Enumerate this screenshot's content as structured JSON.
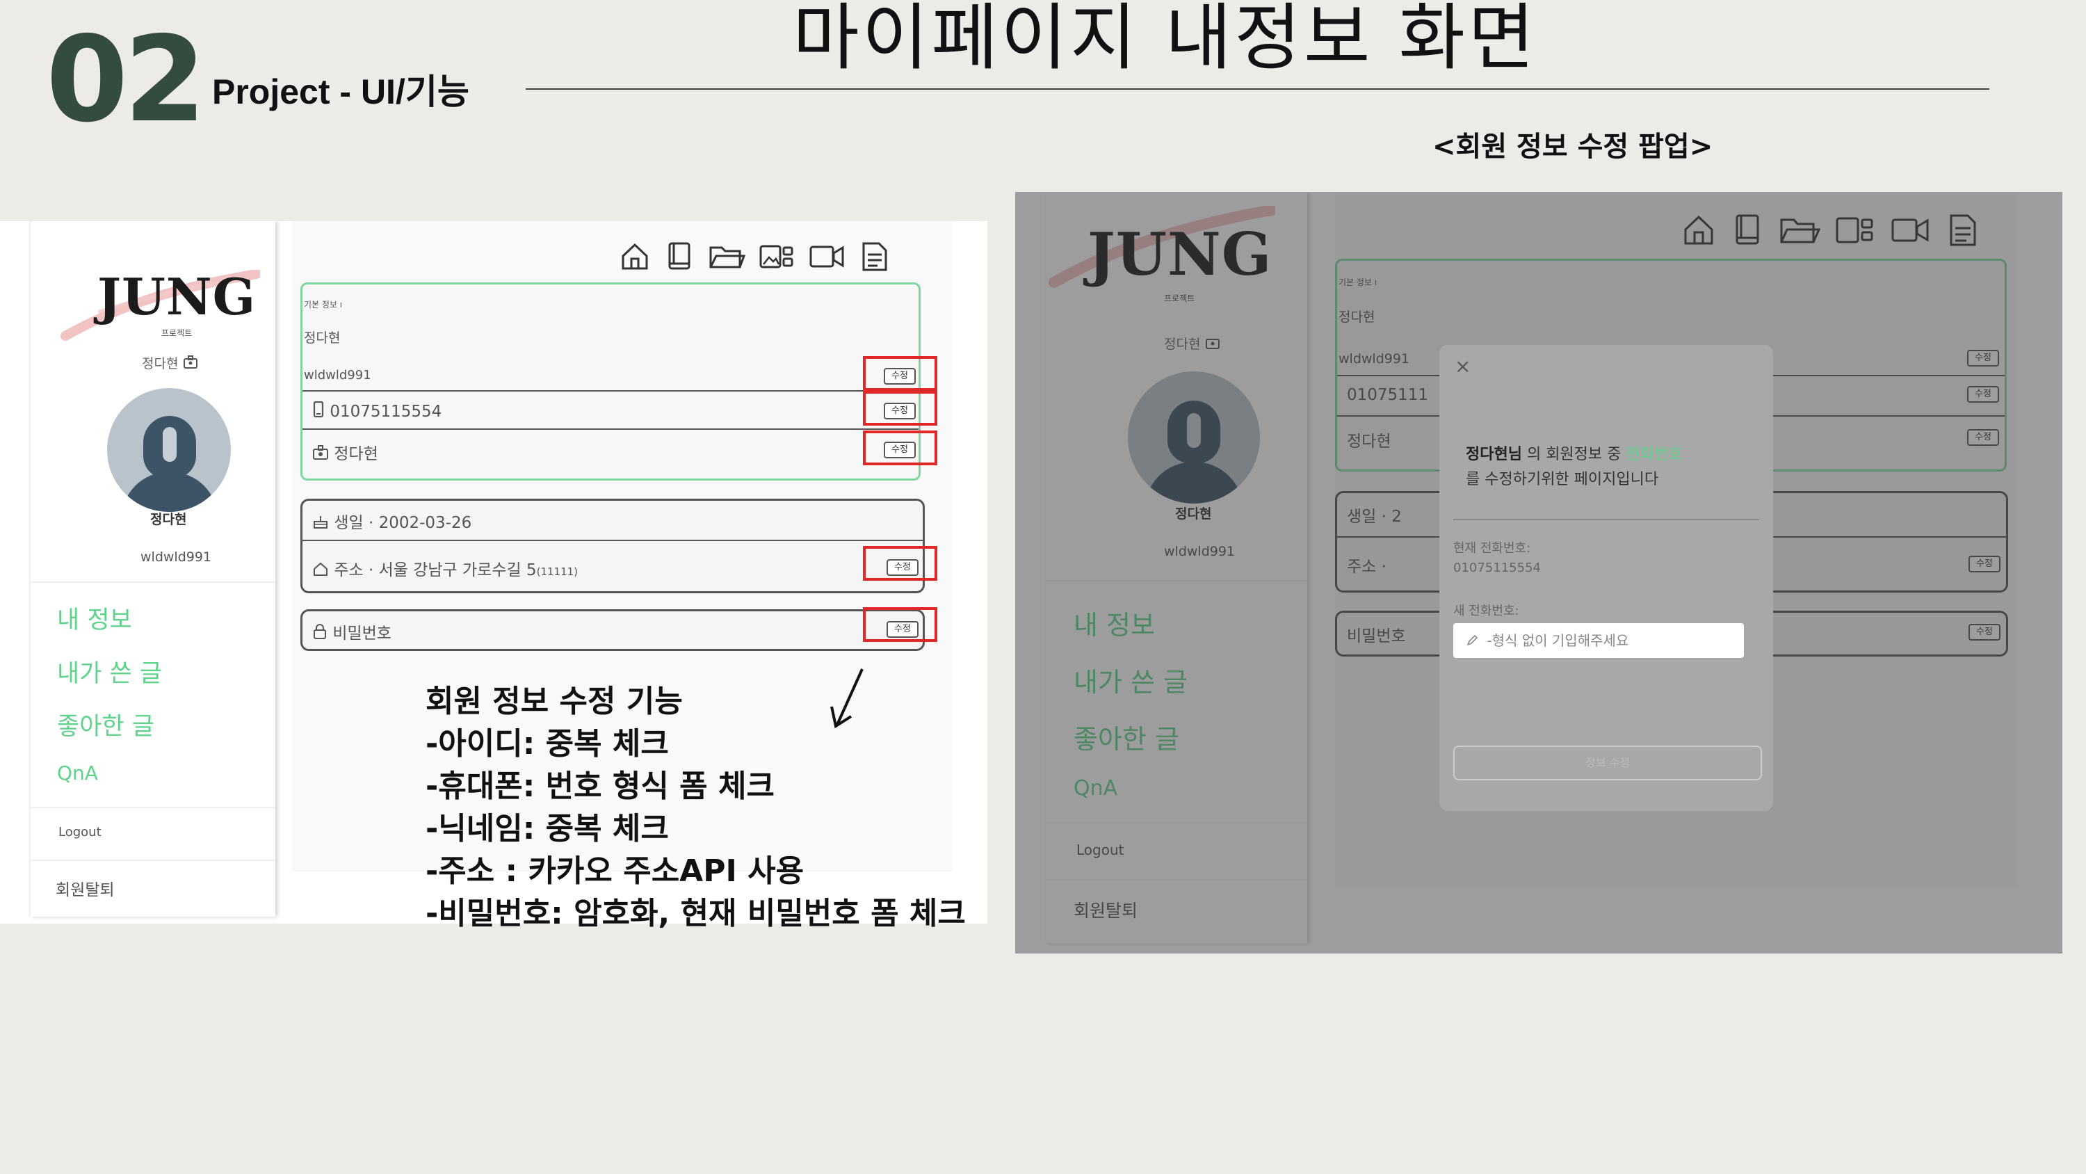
{
  "slide": {
    "number": "02",
    "subtitle": "Project - UI/기능",
    "title": "마이페이지 내정보 화면",
    "popup_caption": "<회원 정보 수정 팝업>"
  },
  "app": {
    "logo": "JUNG",
    "logo_small": "프로젝트",
    "nickname": "정다현",
    "avatar_name": "정다현",
    "user_id": "wldwld991",
    "menu": [
      "내 정보",
      "내가 쓴 글",
      "좋아한 글",
      "QnA"
    ],
    "logout": "Logout",
    "withdraw": "회원탈퇴",
    "top_icons": [
      "home-icon",
      "book-icon",
      "folder-icon",
      "gallery-icon",
      "video-icon",
      "document-icon"
    ]
  },
  "profile_card": {
    "section_label": "기본 정보",
    "name": "정다현",
    "id": "wldwld991",
    "phone": "01075115554",
    "nickname": "정다현",
    "edit_label": "수정"
  },
  "address_card": {
    "birthday_label": "생일",
    "birthday": "2002-03-26",
    "address_label": "주소",
    "address": "서울 강남구 가로수길 5",
    "postal": "(11111)"
  },
  "password_card": {
    "label": "비밀번호"
  },
  "features": [
    "회원 정보 수정 기능",
    "-아이디: 중복 체크",
    "-휴대폰: 번호 형식 폼 체크",
    "-닉네임: 중복 체크",
    "-주소 : 카카오 주소API 사용",
    "-비밀번호: 암호화, 현재 비밀번호 폼 체크"
  ],
  "right_snapshot": {
    "phone_partial": "01075111",
    "birthday_partial": "생일 · 2",
    "address_partial": "주소 ·",
    "password_partial": "비밀번호"
  },
  "modal": {
    "close": "×",
    "user": "정다현님",
    "msg_mid": " 의 회원정보 중 ",
    "field": "전화번호",
    "msg_end": "를 수정하기위한 페이지입니다",
    "current_label": "현재 전화번호:",
    "current_value": "01075115554",
    "new_label": "새 전화번호:",
    "placeholder": "-형식 없이 기입해주세요",
    "submit": "정보 수정"
  }
}
